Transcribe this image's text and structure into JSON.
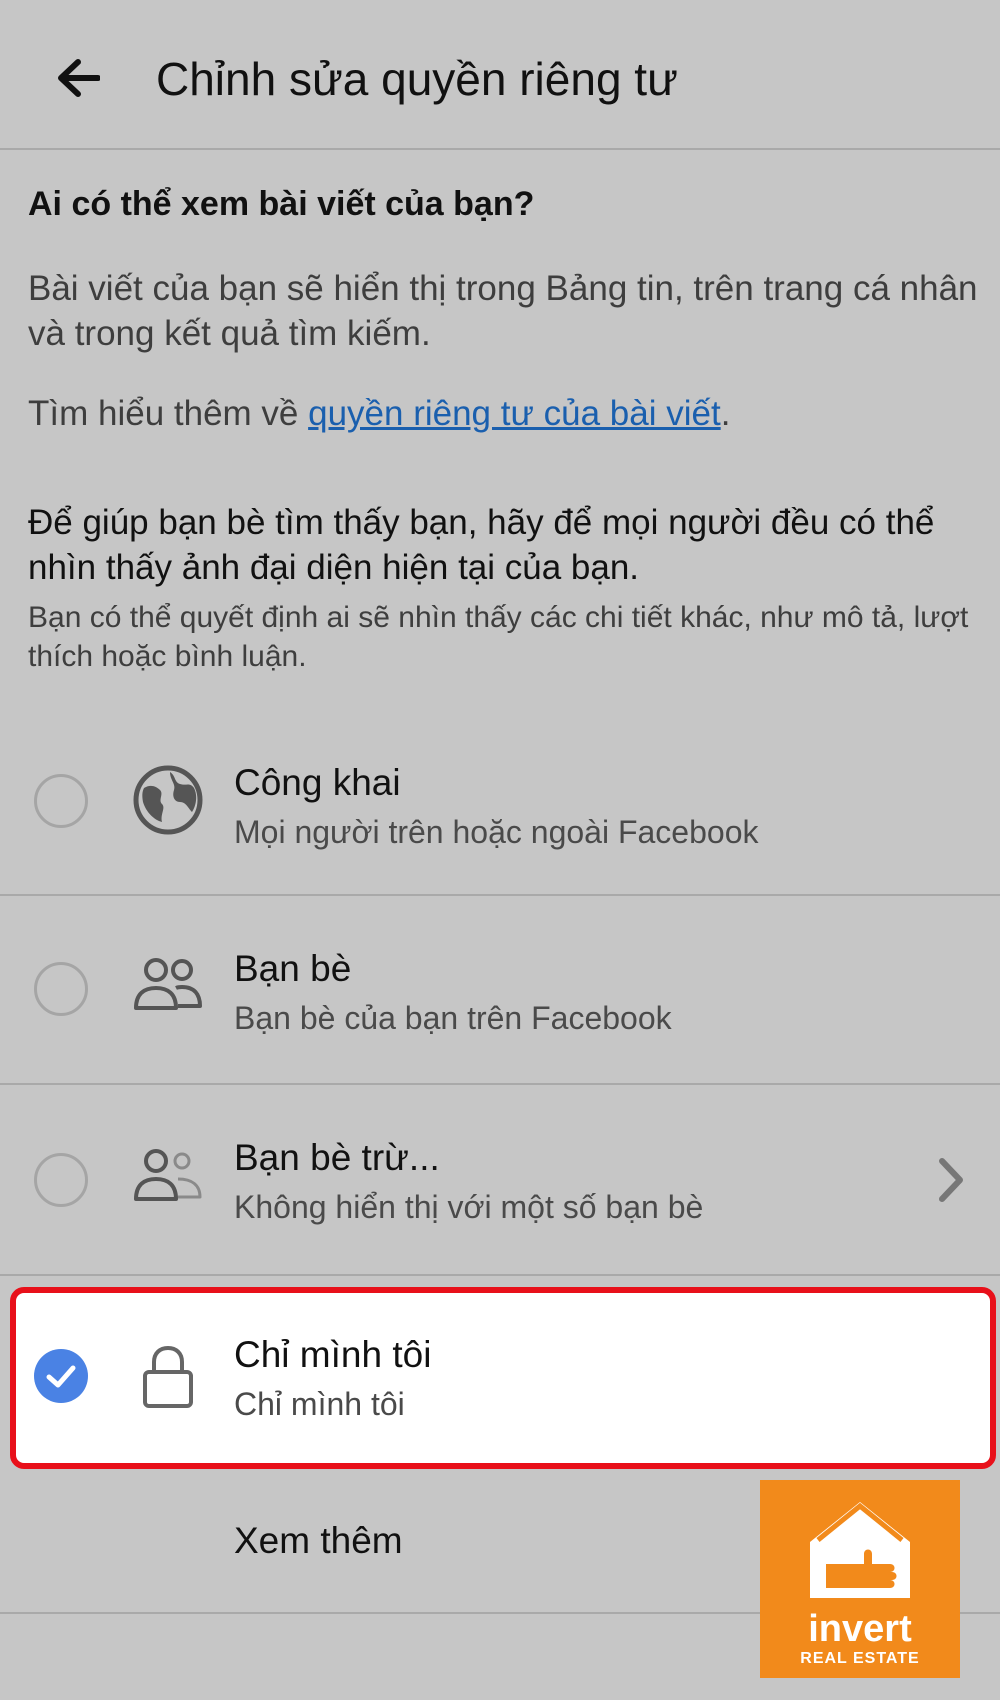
{
  "header": {
    "title": "Chỉnh sửa quyền riêng tư"
  },
  "intro": {
    "question": "Ai có thể xem bài viết của bạn?",
    "description": "Bài viết của bạn sẽ hiển thị trong Bảng tin, trên trang cá nhân và trong kết quả tìm kiếm.",
    "learn_more_prefix": "Tìm hiểu thêm về ",
    "learn_more_link": "quyền riêng tư của bài viết",
    "learn_more_suffix": "."
  },
  "help": {
    "main": "Để giúp bạn bè tìm thấy bạn, hãy để mọi người đều có thể nhìn thấy ảnh đại diện hiện tại của bạn.",
    "sub": "Bạn có thể quyết định ai sẽ nhìn thấy các chi tiết khác, như mô tả, lượt thích hoặc bình luận."
  },
  "options": [
    {
      "title": "Công khai",
      "subtitle": "Mọi người trên hoặc ngoài Facebook",
      "icon": "globe-icon",
      "selected": false
    },
    {
      "title": "Bạn bè",
      "subtitle": "Bạn bè của bạn trên Facebook",
      "icon": "friends-icon",
      "selected": false
    },
    {
      "title": "Bạn bè trừ...",
      "subtitle": "Không hiển thị với một số bạn bè",
      "icon": "friends-except-icon",
      "selected": false
    },
    {
      "title": "Chỉ mình tôi",
      "subtitle": "Chỉ mình tôi",
      "icon": "lock-icon",
      "selected": true
    }
  ],
  "see_more": "Xem thêm",
  "watermark": {
    "name": "invert",
    "tagline": "REAL ESTATE"
  },
  "colors": {
    "background": "#c6c6c6",
    "link": "#1a5fae",
    "check": "#4a82e4",
    "highlight_border": "#e8101a",
    "watermark": "#f28a1b"
  }
}
